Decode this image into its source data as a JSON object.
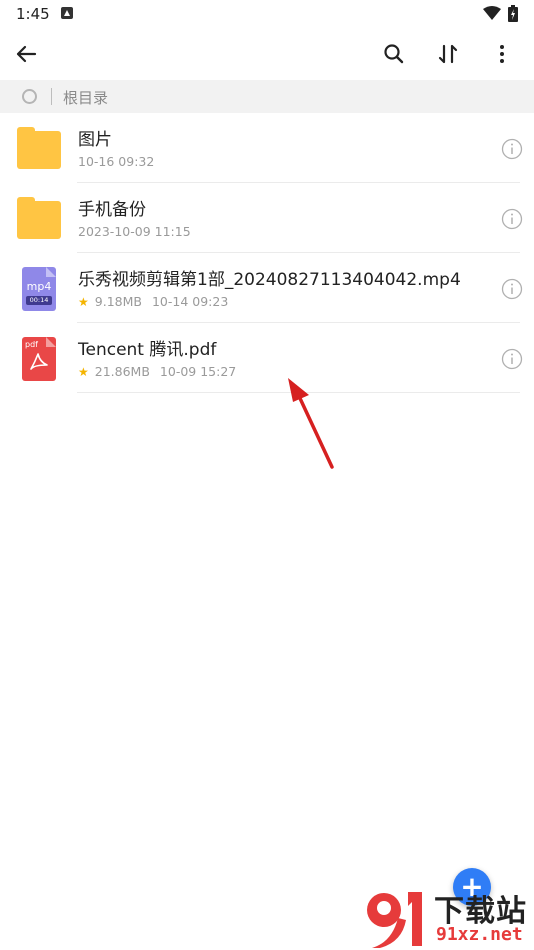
{
  "status_bar": {
    "time": "1:45"
  },
  "breadcrumb": {
    "label": "根目录"
  },
  "files": [
    {
      "type": "folder",
      "name": "图片",
      "date": "10-16 09:32"
    },
    {
      "type": "folder",
      "name": "手机备份",
      "date": "2023-10-09 11:15"
    },
    {
      "type": "video",
      "name": "乐秀视频剪辑第1部_20240827113404042.mp4",
      "size": "9.18MB",
      "date": "10-14 09:23",
      "ext": "mp4",
      "duration": "00:14"
    },
    {
      "type": "pdf",
      "name": "Tencent 腾讯.pdf",
      "size": "21.86MB",
      "date": "10-09 15:27",
      "ext": "pdf"
    }
  ],
  "fab": {
    "symbol": "+"
  },
  "watermark": {
    "cn": "下载站",
    "url": "91xz.net"
  },
  "colors": {
    "accent": "#2f7df6",
    "folder": "#ffc543",
    "video": "#8f88e8",
    "pdf": "#e94747",
    "star": "#f4b400",
    "arrow": "#d62020"
  },
  "icons": [
    "back-arrow-icon",
    "search-icon",
    "sort-icon",
    "more-icon",
    "info-icon",
    "star-icon"
  ]
}
